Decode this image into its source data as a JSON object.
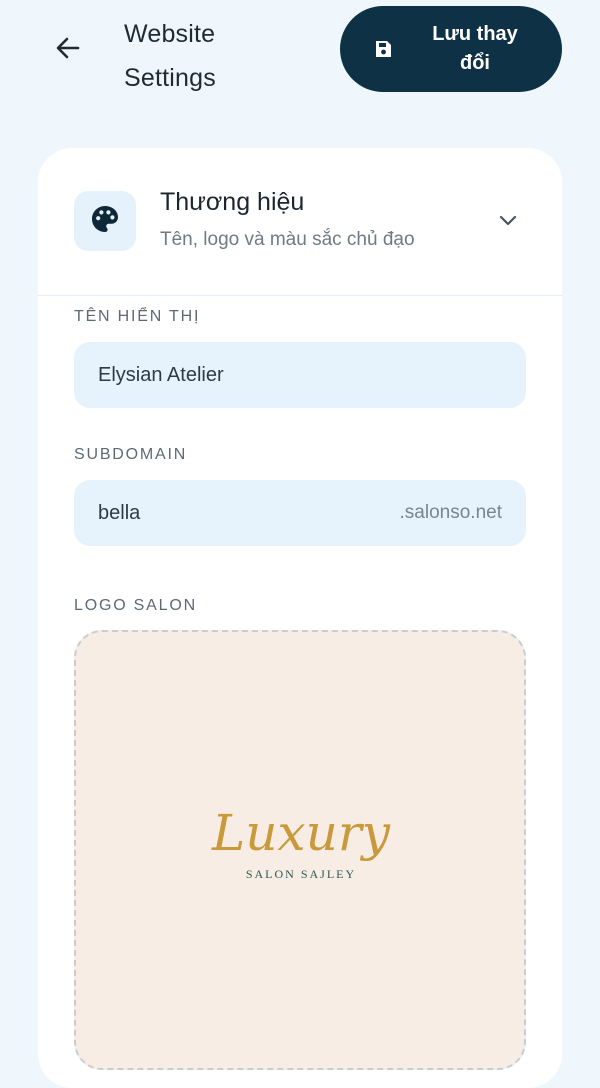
{
  "header": {
    "back_icon": "arrow-left-icon",
    "title": "Website Settings",
    "save_label": "Lưu thay đổi",
    "save_icon": "save-icon",
    "save_bg": "#0f3145"
  },
  "branding": {
    "icon": "palette-icon",
    "title": "Thương hiệu",
    "subtitle": "Tên, logo và màu sắc chủ đạo",
    "expand_icon": "chevron-down-icon"
  },
  "fields": {
    "display_name_label": "TÊN HIỂN THỊ",
    "display_name_value": "Elysian Atelier",
    "subdomain_label": "SUBDOMAIN",
    "subdomain_value": "bella",
    "subdomain_suffix": ".salonso.net",
    "logo_label": "LOGO SALON"
  },
  "logo": {
    "wordmark": "Luxury",
    "tagline": "SALON SAJLEY",
    "gold": "#c99a3c",
    "teal": "#2c5a52"
  }
}
